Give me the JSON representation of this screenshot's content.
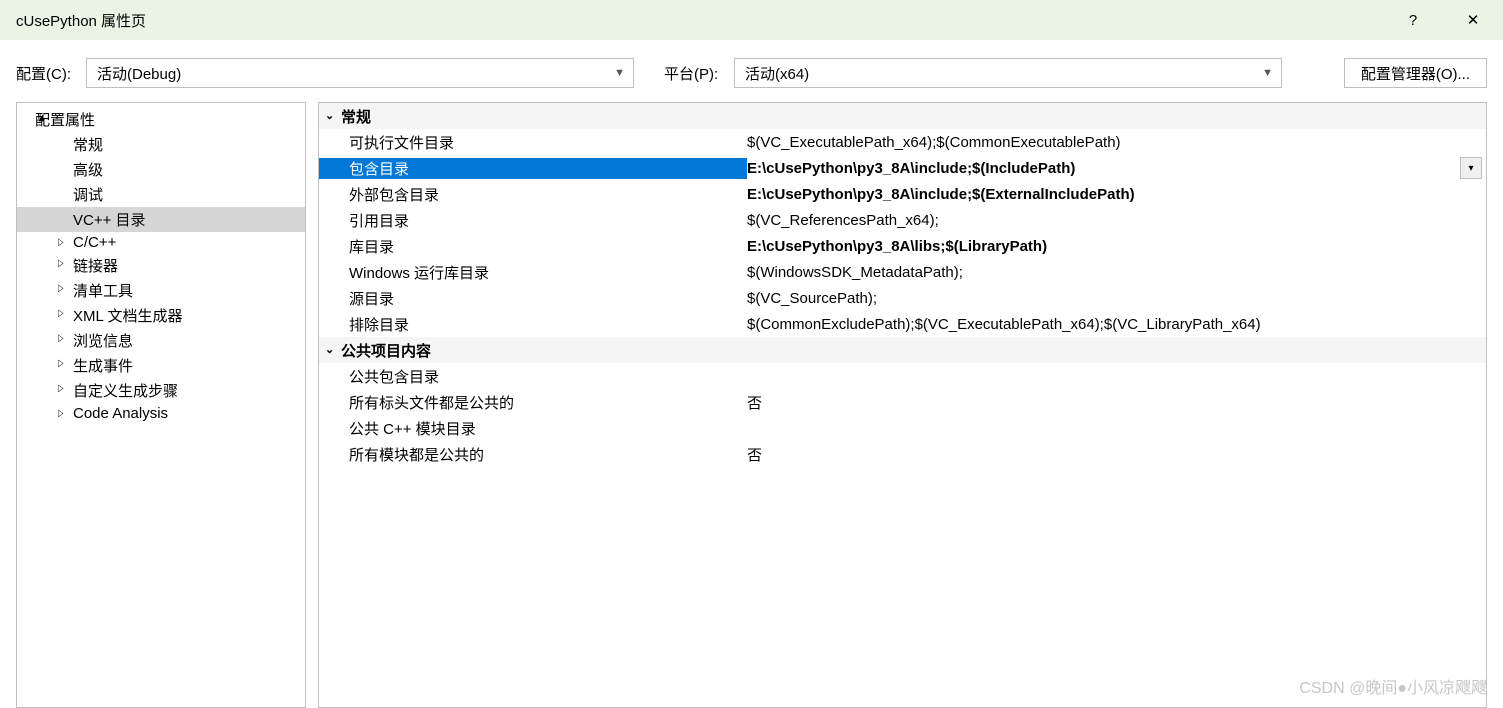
{
  "titlebar": {
    "title": "cUsePython 属性页",
    "help": "?",
    "close": "✕"
  },
  "config_row": {
    "config_label": "配置(C):",
    "config_value": "活动(Debug)",
    "platform_label": "平台(P):",
    "platform_value": "活动(x64)",
    "config_mgr": "配置管理器(O)..."
  },
  "tree": {
    "root": "配置属性",
    "items": [
      {
        "label": "常规",
        "caret": false
      },
      {
        "label": "高级",
        "caret": false
      },
      {
        "label": "调试",
        "caret": false
      },
      {
        "label": "VC++ 目录",
        "caret": false,
        "selected": true
      },
      {
        "label": "C/C++",
        "caret": true
      },
      {
        "label": "链接器",
        "caret": true
      },
      {
        "label": "清单工具",
        "caret": true
      },
      {
        "label": "XML 文档生成器",
        "caret": true
      },
      {
        "label": "浏览信息",
        "caret": true
      },
      {
        "label": "生成事件",
        "caret": true
      },
      {
        "label": "自定义生成步骤",
        "caret": true
      },
      {
        "label": "Code Analysis",
        "caret": true
      }
    ]
  },
  "grid": {
    "sections": [
      {
        "title": "常规",
        "rows": [
          {
            "label": "可执行文件目录",
            "value": "$(VC_ExecutablePath_x64);$(CommonExecutablePath)",
            "bold": false,
            "selected": false
          },
          {
            "label": "包含目录",
            "value": "E:\\cUsePython\\py3_8A\\include;$(IncludePath)",
            "bold": true,
            "selected": true
          },
          {
            "label": "外部包含目录",
            "value": "E:\\cUsePython\\py3_8A\\include;$(ExternalIncludePath)",
            "bold": true,
            "selected": false
          },
          {
            "label": "引用目录",
            "value": "$(VC_ReferencesPath_x64);",
            "bold": false,
            "selected": false
          },
          {
            "label": "库目录",
            "value": "E:\\cUsePython\\py3_8A\\libs;$(LibraryPath)",
            "bold": true,
            "selected": false
          },
          {
            "label": "Windows 运行库目录",
            "value": "$(WindowsSDK_MetadataPath);",
            "bold": false,
            "selected": false
          },
          {
            "label": "源目录",
            "value": "$(VC_SourcePath);",
            "bold": false,
            "selected": false
          },
          {
            "label": "排除目录",
            "value": "$(CommonExcludePath);$(VC_ExecutablePath_x64);$(VC_LibraryPath_x64)",
            "bold": false,
            "selected": false
          }
        ]
      },
      {
        "title": "公共项目内容",
        "rows": [
          {
            "label": "公共包含目录",
            "value": "",
            "bold": false,
            "selected": false
          },
          {
            "label": "所有标头文件都是公共的",
            "value": "否",
            "bold": false,
            "selected": false
          },
          {
            "label": "公共 C++ 模块目录",
            "value": "",
            "bold": false,
            "selected": false
          },
          {
            "label": "所有模块都是公共的",
            "value": "否",
            "bold": false,
            "selected": false
          }
        ]
      }
    ]
  },
  "watermark": "CSDN @晚间●小风凉飕飕"
}
